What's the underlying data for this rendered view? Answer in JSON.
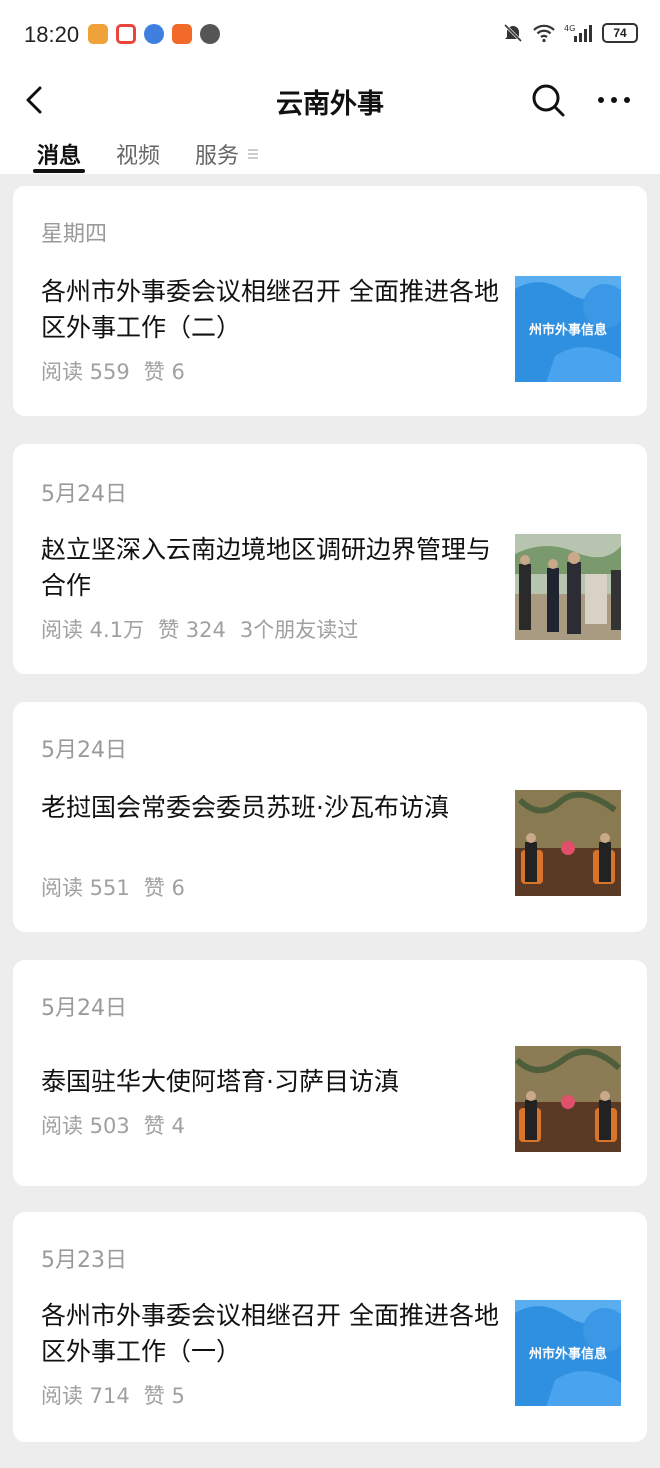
{
  "status_bar": {
    "time": "18:20",
    "battery": "74",
    "network": "4G"
  },
  "header": {
    "title": "云南外事",
    "back_icon": "chevron-left-icon",
    "search_icon": "search-icon",
    "more_icon": "more-icon"
  },
  "tabs": [
    {
      "label": "消息",
      "active": true
    },
    {
      "label": "视频",
      "active": false
    },
    {
      "label": "服务",
      "active": false
    }
  ],
  "articles": [
    {
      "date": "星期四",
      "title": "各州市外事委会议相继召开 全面推进各地区外事工作（二）",
      "reads": "阅读 559",
      "likes": "赞 6",
      "friends": "",
      "thumb_text": "州市外事信息"
    },
    {
      "date": "5月24日",
      "title": "赵立坚深入云南边境地区调研边界管理与合作",
      "reads": "阅读 4.1万",
      "likes": "赞 324",
      "friends": "3个朋友读过",
      "thumb_text": ""
    },
    {
      "date": "5月24日",
      "title": "老挝国会常委会委员苏班·沙瓦布访滇",
      "reads": "阅读 551",
      "likes": "赞 6",
      "friends": "",
      "thumb_text": ""
    },
    {
      "date": "5月24日",
      "title": "泰国驻华大使阿塔育·习萨目访滇",
      "reads": "阅读 503",
      "likes": "赞 4",
      "friends": "",
      "thumb_text": ""
    },
    {
      "date": "5月23日",
      "title": "各州市外事委会议相继召开 全面推进各地区外事工作（一）",
      "reads": "阅读 714",
      "likes": "赞 5",
      "friends": "",
      "thumb_text": "州市外事信息"
    }
  ],
  "colors": {
    "page_bg": "#ededed",
    "card_bg": "#ffffff",
    "muted_text": "#9a9a9a",
    "thumb_blue": "#2f8fe0"
  }
}
